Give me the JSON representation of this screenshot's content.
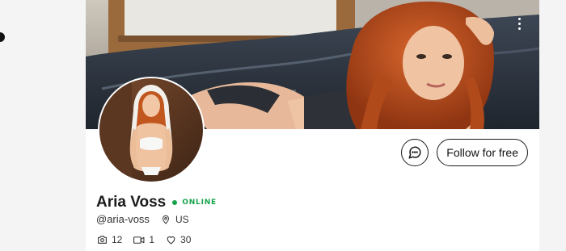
{
  "profile": {
    "display_name": "Aria Voss",
    "status": "ONLINE",
    "handle": "@aria-voss",
    "location": "US"
  },
  "stats": {
    "photos": "12",
    "videos": "1",
    "likes": "30"
  },
  "actions": {
    "follow_label": "Follow for free"
  },
  "icons": {
    "more": "more-vertical-icon",
    "message": "message-icon",
    "location": "location-pin-icon",
    "photos": "camera-icon",
    "videos": "video-icon",
    "likes": "heart-icon"
  },
  "colors": {
    "online": "#16a34a",
    "text": "#1b1b1b"
  }
}
